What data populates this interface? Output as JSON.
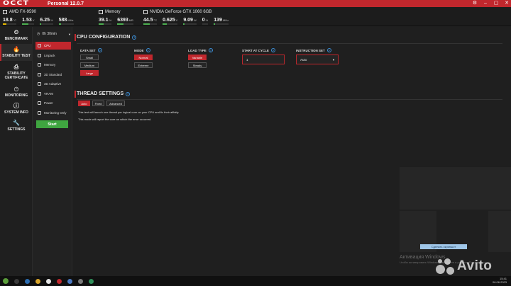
{
  "app": {
    "logo": "OCCT",
    "title": "Personal 12.0.7",
    "controls": [
      "⚙",
      "–",
      "▢",
      "✕"
    ]
  },
  "sensors": {
    "cpu": {
      "name": "AMD FX-9590",
      "values": [
        {
          "value": "18.8",
          "unit": "°C",
          "fill": 0.25,
          "highlight": true
        },
        {
          "value": "1.53",
          "unit": "V",
          "fill": 0.5,
          "highlight": false
        },
        {
          "value": "6.25",
          "unit": "%",
          "fill": 0.06,
          "highlight": false
        },
        {
          "value": "588",
          "unit": "MHz",
          "fill": 0.15,
          "highlight": false
        }
      ]
    },
    "memory": {
      "name": "Memory",
      "values": [
        {
          "value": "39.1",
          "unit": "%",
          "fill": 0.39
        },
        {
          "value": "6393",
          "unit": "MB",
          "fill": 0.4
        }
      ]
    },
    "gpu": {
      "name": "NVIDIA GeForce GTX 1060 6GB",
      "values": [
        {
          "value": "44.5",
          "unit": "°C",
          "fill": 0.45
        },
        {
          "value": "0.625",
          "unit": "V",
          "fill": 0.3
        },
        {
          "value": "9.09",
          "unit": "W",
          "fill": 0.08
        },
        {
          "value": "0",
          "unit": "%",
          "fill": 0.0
        },
        {
          "value": "139",
          "unit": "MHz",
          "fill": 0.08
        }
      ]
    }
  },
  "leftnav": [
    {
      "label": "BENCHMARK",
      "icon": "⏲",
      "active": false
    },
    {
      "label": "STABILITY TEST",
      "icon": "🔥",
      "active": true
    },
    {
      "label": "STABILITY CERTIFICATE",
      "icon": "⎙",
      "active": false
    },
    {
      "label": "MONITORING",
      "icon": "◷",
      "active": false
    },
    {
      "label": "SYSTEM INFO",
      "icon": "ⓘ",
      "active": false
    },
    {
      "label": "SETTINGS",
      "icon": "🔧",
      "active": false
    }
  ],
  "subnav": {
    "duration": "0h 30min",
    "items": [
      {
        "label": "CPU",
        "active": true
      },
      {
        "label": "Linpack",
        "active": false
      },
      {
        "label": "Memory",
        "active": false
      },
      {
        "label": "3D Standard",
        "active": false
      },
      {
        "label": "3D Adaptive",
        "active": false
      },
      {
        "label": "VRAM",
        "active": false
      },
      {
        "label": "Power",
        "active": false
      },
      {
        "label": "Monitoring Only",
        "active": false
      }
    ],
    "start_label": "Start"
  },
  "cpu_config": {
    "heading": "CPU CONFIGURATION",
    "data_set": {
      "label": "DATA SET",
      "options": [
        "Small",
        "Medium",
        "Large"
      ],
      "selected": "Large"
    },
    "mode": {
      "label": "MODE",
      "options": [
        "Normal",
        "Extreme"
      ],
      "selected": "Normal"
    },
    "load_type": {
      "label": "LOAD TYPE",
      "options": [
        "Variable",
        "Steady"
      ],
      "selected": "Variable"
    },
    "start_at_cycle": {
      "label": "START AT CYCLE",
      "value": "1"
    },
    "instruction_set": {
      "label": "INSTRUCTION SET",
      "value": "Auto"
    }
  },
  "thread_settings": {
    "heading": "THREAD SETTINGS",
    "options": [
      "Auto",
      "Fixed",
      "Advanced"
    ],
    "selected": "Auto",
    "desc1": "This test will launch one thread per logical core on your CPU and fix their affinity.",
    "desc2": "This mode will report the core on which the error occurred."
  },
  "overlay": {
    "tooltip": "Сделать скриншот",
    "activate_title": "Активация Windows",
    "activate_sub": "Чтобы активировать Windows, перейдите в раздел «Параметры».",
    "watermark": "Avito"
  },
  "taskbar": {
    "time": "15:41",
    "date": "06.06.2023"
  },
  "colors": {
    "accent": "#c1272d",
    "start": "#3fa540",
    "help": "#3d8fd6"
  }
}
